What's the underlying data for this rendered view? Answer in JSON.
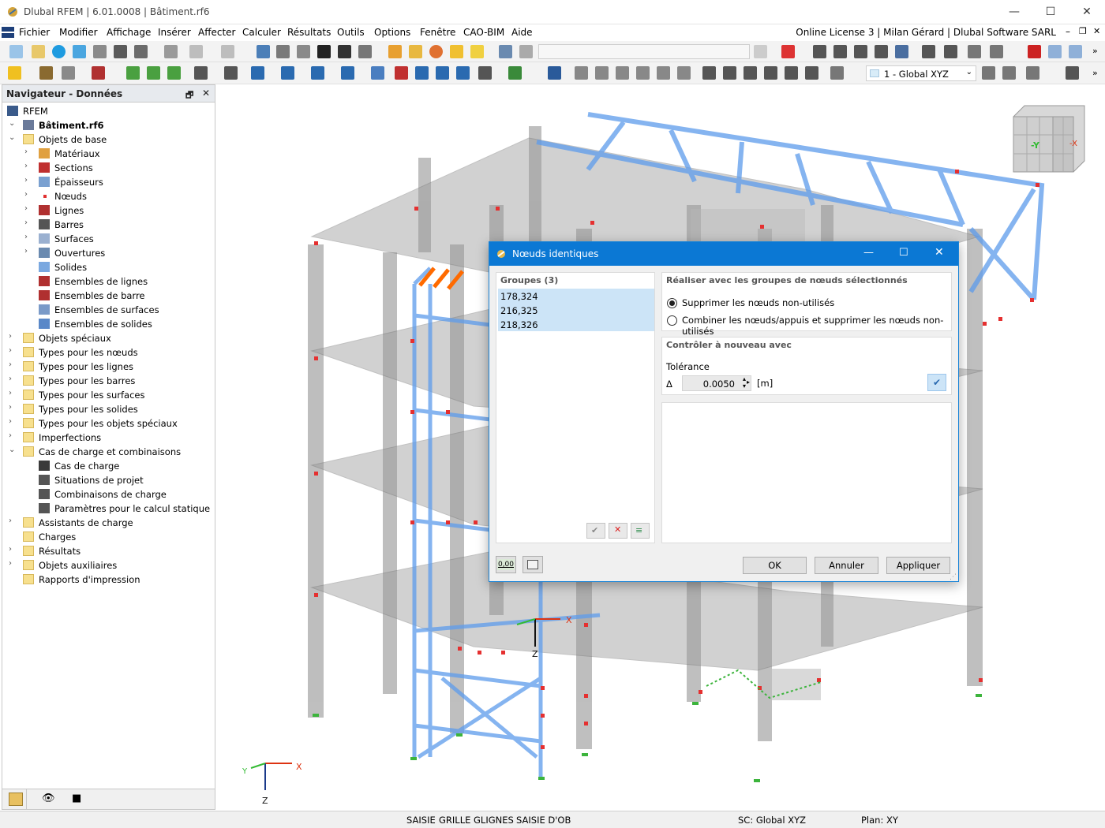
{
  "window": {
    "title": "Dlubal RFEM | 6.01.0008 | Bâtiment.rf6"
  },
  "menu": {
    "items": [
      "Fichier",
      "Modifier",
      "Affichage",
      "Insérer",
      "Affecter",
      "Calculer",
      "Résultats",
      "Outils",
      "Options",
      "Fenêtre",
      "CAO-BIM",
      "Aide"
    ],
    "license": "Online License 3 | Milan Gérard | Dlubal Software SARL"
  },
  "toolbar": {
    "coord_system": "1 - Global XYZ"
  },
  "navigator": {
    "title": "Navigateur - Données",
    "root": "RFEM",
    "file": "Bâtiment.rf6",
    "items": [
      {
        "label": "Objets de base",
        "level": 1,
        "expanded": true,
        "icon": "folder-icon"
      },
      {
        "label": "Matériaux",
        "level": 2,
        "icon": "materials-icon"
      },
      {
        "label": "Sections",
        "level": 2,
        "icon": "section-icon"
      },
      {
        "label": "Épaisseurs",
        "level": 2,
        "icon": "thickness-icon"
      },
      {
        "label": "Nœuds",
        "level": 2,
        "icon": "node-icon"
      },
      {
        "label": "Lignes",
        "level": 2,
        "icon": "line-icon"
      },
      {
        "label": "Barres",
        "level": 2,
        "icon": "member-icon"
      },
      {
        "label": "Surfaces",
        "level": 2,
        "icon": "surface-icon"
      },
      {
        "label": "Ouvertures",
        "level": 2,
        "icon": "opening-icon"
      },
      {
        "label": "Solides",
        "level": 2,
        "leaf": true,
        "icon": "solid-icon"
      },
      {
        "label": "Ensembles de lignes",
        "level": 2,
        "leaf": true,
        "icon": "line-set-icon"
      },
      {
        "label": "Ensembles de barre",
        "level": 2,
        "leaf": true,
        "icon": "member-set-icon"
      },
      {
        "label": "Ensembles de surfaces",
        "level": 2,
        "leaf": true,
        "icon": "surface-set-icon"
      },
      {
        "label": "Ensembles de solides",
        "level": 2,
        "leaf": true,
        "icon": "solid-set-icon"
      },
      {
        "label": "Objets spéciaux",
        "level": 1,
        "icon": "folder-icon"
      },
      {
        "label": "Types pour les nœuds",
        "level": 1,
        "icon": "folder-icon"
      },
      {
        "label": "Types pour les lignes",
        "level": 1,
        "icon": "folder-icon"
      },
      {
        "label": "Types pour les barres",
        "level": 1,
        "icon": "folder-icon"
      },
      {
        "label": "Types pour les surfaces",
        "level": 1,
        "icon": "folder-icon"
      },
      {
        "label": "Types pour les solides",
        "level": 1,
        "icon": "folder-icon"
      },
      {
        "label": "Types pour les objets spéciaux",
        "level": 1,
        "icon": "folder-icon"
      },
      {
        "label": "Imperfections",
        "level": 1,
        "icon": "folder-icon"
      },
      {
        "label": "Cas de charge et combinaisons",
        "level": 1,
        "expanded": true,
        "icon": "folder-icon"
      },
      {
        "label": "Cas de charge",
        "level": 2,
        "leaf": true,
        "icon": "load-case-icon"
      },
      {
        "label": "Situations de projet",
        "level": 2,
        "leaf": true,
        "icon": "design-situation-icon"
      },
      {
        "label": "Combinaisons de charge",
        "level": 2,
        "leaf": true,
        "icon": "load-combination-icon"
      },
      {
        "label": "Paramètres pour le calcul statique",
        "level": 2,
        "leaf": true,
        "icon": "static-params-icon"
      },
      {
        "label": "Assistants de charge",
        "level": 1,
        "icon": "folder-icon"
      },
      {
        "label": "Charges",
        "level": 1,
        "leaf": true,
        "icon": "folder-icon"
      },
      {
        "label": "Résultats",
        "level": 1,
        "icon": "folder-icon"
      },
      {
        "label": "Objets auxiliaires",
        "level": 1,
        "icon": "folder-icon"
      },
      {
        "label": "Rapports d'impression",
        "level": 1,
        "leaf": true,
        "icon": "folder-icon"
      }
    ]
  },
  "viewport": {
    "axis_x": "X",
    "axis_y": "Y",
    "axis_z": "Z",
    "cube_minus_y": "-Y",
    "cube_minus_x": "-X",
    "axis_local_x": "X",
    "axis_local_z": "Z"
  },
  "dialog": {
    "title": "Nœuds identiques",
    "groups_header": "Groupes (3)",
    "groups": [
      "178,324",
      "216,325",
      "218,326"
    ],
    "action_header": "Réaliser avec les groupes de nœuds sélectionnés",
    "option1": "Supprimer les nœuds non-utilisés",
    "option2": "Combiner les nœuds/appuis et supprimer les nœuds non-utilisés",
    "selected_option": 1,
    "check_header": "Contrôler à nouveau avec",
    "tolerance_label": "Tolérance",
    "delta_symbol": "Δ",
    "tolerance_value": "0.0050",
    "tolerance_unit": "[m]",
    "units_badge": "0,00",
    "ok": "OK",
    "cancel": "Annuler",
    "apply": "Appliquer"
  },
  "status": {
    "items": [
      "SAISIE",
      "GRILLE",
      "GLIGNES",
      "SAISIE D'OB"
    ],
    "cs": "SC: Global XYZ",
    "plane": "Plan: XY"
  }
}
